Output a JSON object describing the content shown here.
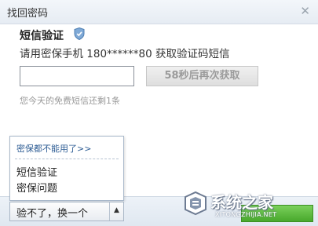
{
  "dialog": {
    "title": "找回密码",
    "close_icon": "close-icon"
  },
  "sms": {
    "section_title": "短信验证",
    "description": "请用密保手机 180******80 获取验证码短信",
    "code_value": "",
    "resend_label": "58秒后再次获取",
    "hint": "您今天的免费短信还剩1条"
  },
  "alternatives": {
    "link_label": "密保都不能用了>>",
    "items": [
      "短信验证",
      "密保问题"
    ]
  },
  "switch_button": {
    "label": "验不了，换一个",
    "icon": "caret-up-icon"
  },
  "watermark": {
    "name": "系统之家",
    "url": "XITONGZHIJIA.NET"
  },
  "colors": {
    "link": "#2f5e95",
    "next_button": "#5cbb3e",
    "titlebar": "#e6ecf3"
  }
}
